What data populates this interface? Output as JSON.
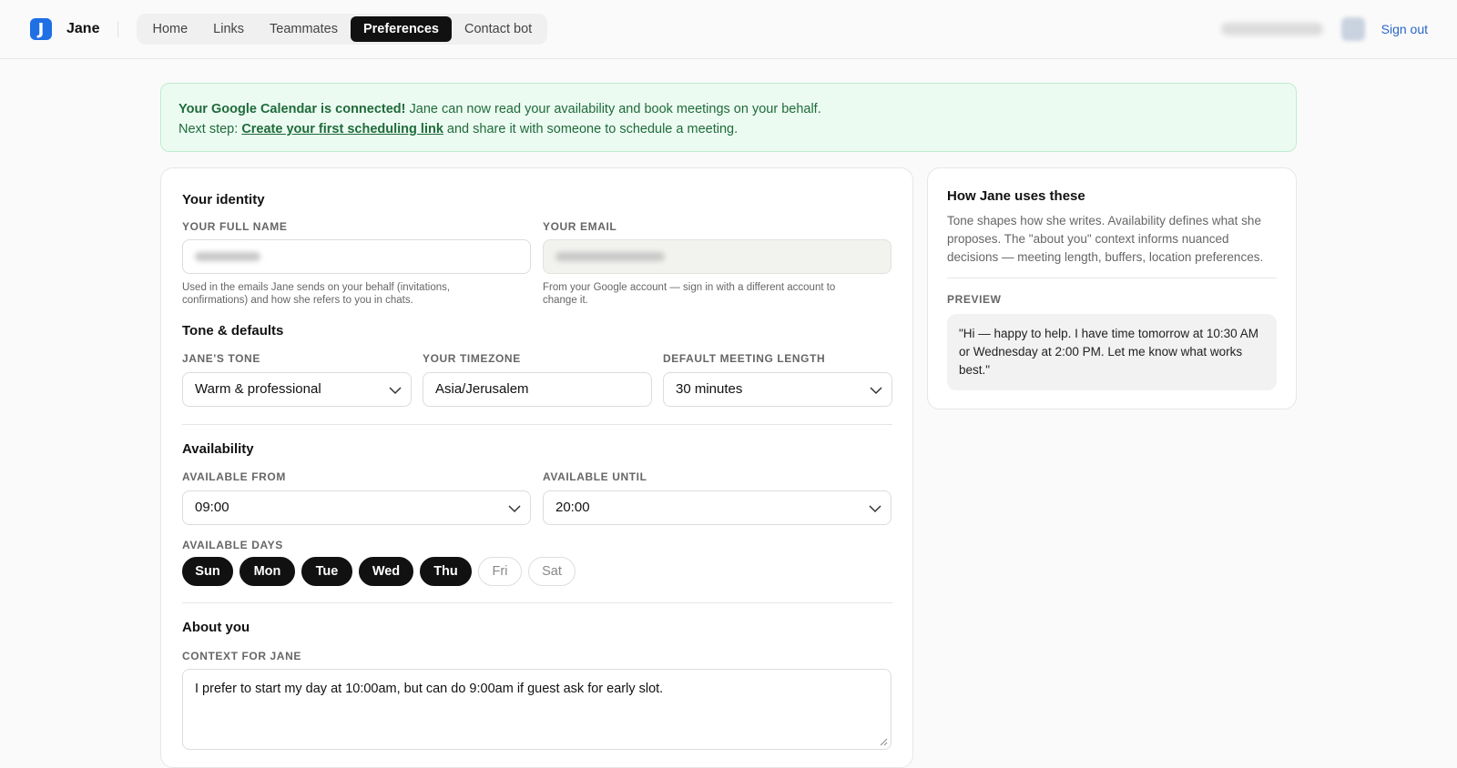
{
  "header": {
    "logo_letter": "J",
    "brand": "Jane",
    "nav": [
      {
        "label": "Home"
      },
      {
        "label": "Links"
      },
      {
        "label": "Teammates"
      },
      {
        "label": "Preferences",
        "active": true
      },
      {
        "label": "Contact bot"
      }
    ],
    "sign_out": "Sign out"
  },
  "banner": {
    "strong": "Your Google Calendar is connected!",
    "text1": " Jane can now read your availability and book meetings on your behalf.",
    "next_prefix": "Next step: ",
    "link": "Create your first scheduling link",
    "next_suffix": " and share it with someone to schedule a meeting."
  },
  "identity": {
    "title": "Your identity",
    "full_name_label": "YOUR FULL NAME",
    "full_name_help": "Used in the emails Jane sends on your behalf (invitations, confirmations) and how she refers to you in chats.",
    "email_label": "YOUR EMAIL",
    "email_help": "From your Google account — sign in with a different account to change it."
  },
  "tone": {
    "title": "Tone & defaults",
    "tone_label": "JANE'S TONE",
    "tone_value": "Warm & professional",
    "timezone_label": "YOUR TIMEZONE",
    "timezone_value": "Asia/Jerusalem",
    "length_label": "DEFAULT MEETING LENGTH",
    "length_value": "30 minutes"
  },
  "availability": {
    "title": "Availability",
    "from_label": "AVAILABLE FROM",
    "from_value": "09:00",
    "until_label": "AVAILABLE UNTIL",
    "until_value": "20:00",
    "days_label": "AVAILABLE DAYS",
    "days": [
      {
        "label": "Sun",
        "selected": true
      },
      {
        "label": "Mon",
        "selected": true
      },
      {
        "label": "Tue",
        "selected": true
      },
      {
        "label": "Wed",
        "selected": true
      },
      {
        "label": "Thu",
        "selected": true
      },
      {
        "label": "Fri",
        "selected": false
      },
      {
        "label": "Sat",
        "selected": false
      }
    ]
  },
  "about": {
    "title": "About you",
    "context_label": "CONTEXT FOR JANE",
    "context_value": "I prefer to start my day at 10:00am, but can do 9:00am if guest ask for early slot."
  },
  "side": {
    "title": "How Jane uses these",
    "description": "Tone shapes how she writes. Availability defines what she proposes. The \"about you\" context informs nuanced decisions — meeting length, buffers, location preferences.",
    "preview_label": "PREVIEW",
    "preview_text": "\"Hi — happy to help. I have time tomorrow at 10:30 AM or Wednesday at 2:00 PM. Let me know what works best.\""
  },
  "colors": {
    "accent": "#1f6fe5",
    "banner_bg": "#ecfbf2",
    "banner_text": "#1f6b3a",
    "selected_day": "#111111"
  }
}
